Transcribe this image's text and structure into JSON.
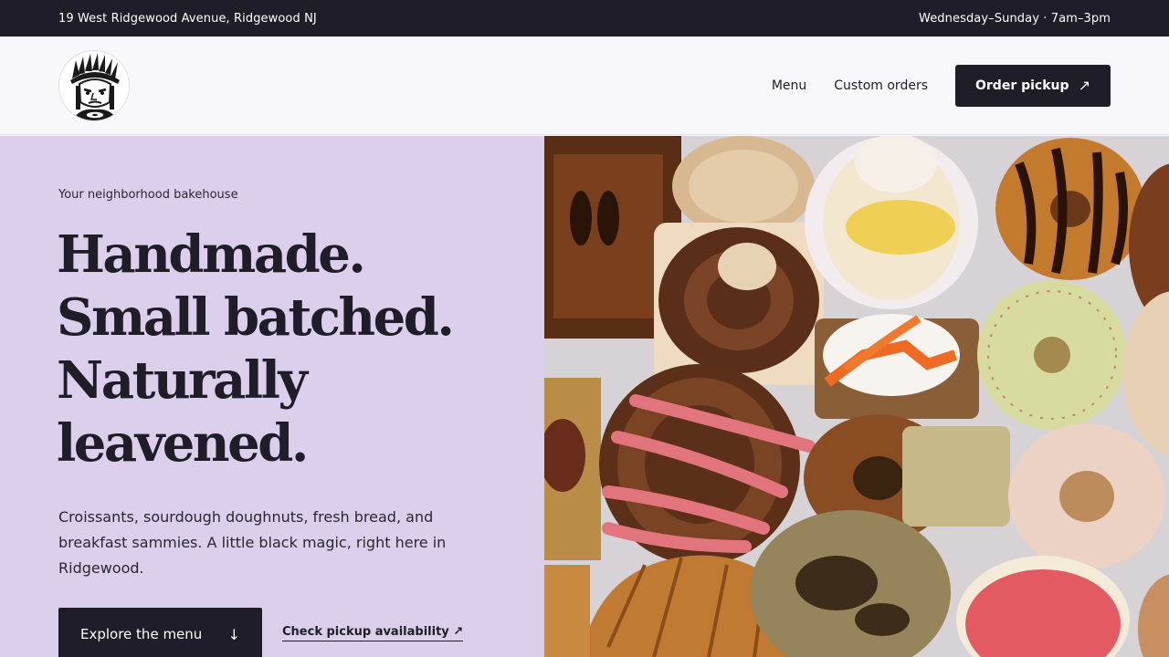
{
  "topbar": {
    "address": "19 West Ridgewood Avenue, Ridgewood NJ",
    "hours": "Wednesday–Sunday · 7am–3pm"
  },
  "header": {
    "logo_icon": "bakery-mascot-logo",
    "nav": [
      {
        "label": "Menu"
      },
      {
        "label": "Custom orders"
      }
    ],
    "order_button": {
      "label": "Order pickup",
      "icon": "arrow-up-right-icon"
    }
  },
  "hero": {
    "eyebrow": "Your neighborhood bakehouse",
    "headline": [
      "Handmade.",
      "Small batched.",
      "Naturally",
      "leavened."
    ],
    "description": "Croissants, sourdough doughnuts, fresh bread, and breakfast sammies. A little black magic, right here in Ridgewood.",
    "explore_button": {
      "label": "Explore the menu",
      "icon": "arrow-down-icon"
    },
    "check_link": {
      "label": "Check pickup availability",
      "icon": "arrow-up-right-icon"
    },
    "image": "pastry-tray-photo"
  },
  "colors": {
    "dark": "#1f1d27",
    "hero_bg": "#dbcfec",
    "header_bg": "#f8f7fb"
  }
}
